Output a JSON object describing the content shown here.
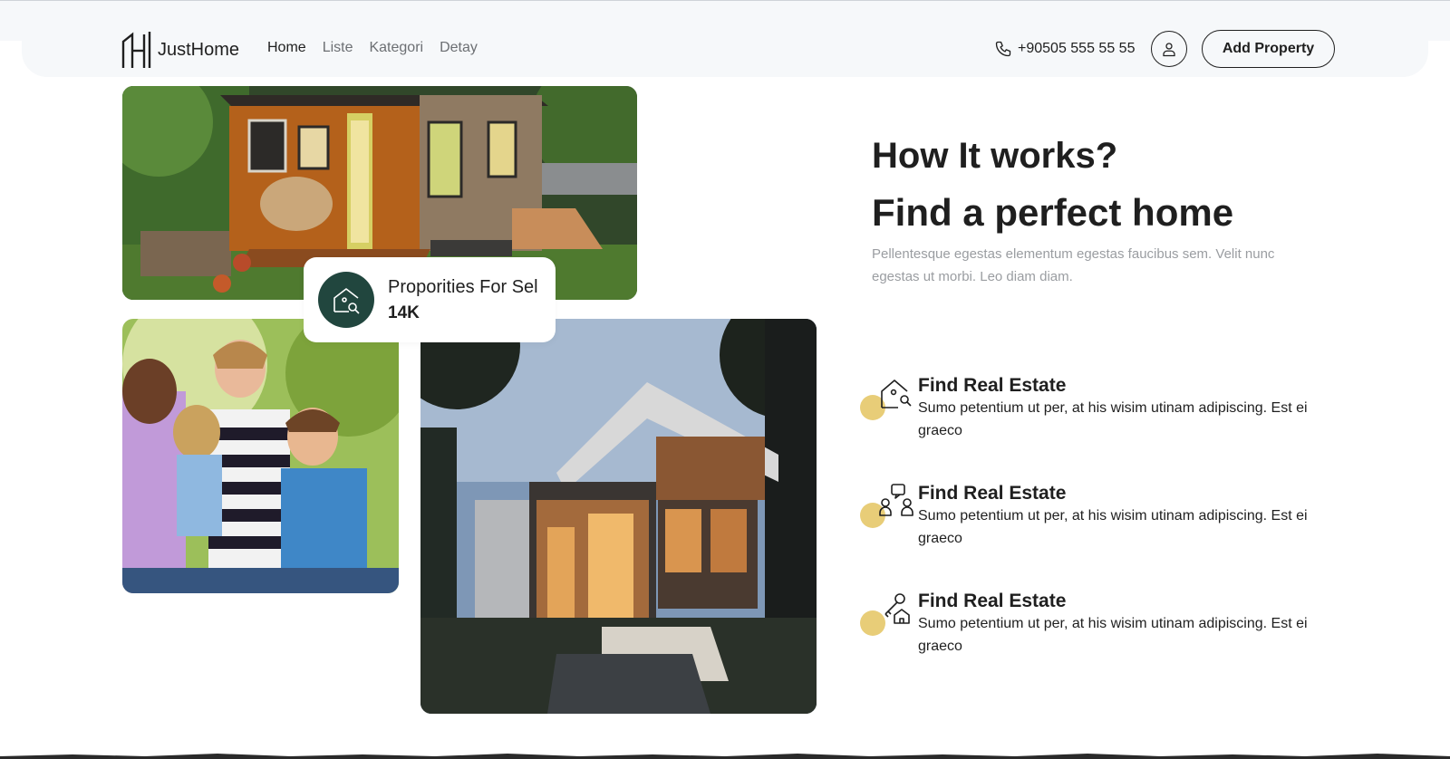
{
  "header": {
    "brand": "JustHome",
    "logo_icon": "justhome-logo-icon",
    "nav": [
      {
        "label": "Home",
        "active": true
      },
      {
        "label": "Liste",
        "active": false
      },
      {
        "label": "Kategori",
        "active": false
      },
      {
        "label": "Detay",
        "active": false
      }
    ],
    "phone": "+90505 555 55 55",
    "phone_icon": "phone-icon",
    "user_icon": "user-icon",
    "add_property": "Add Property"
  },
  "gallery": {
    "images": [
      "tiny-house-photo",
      "family-photo",
      "modern-house-photo"
    ],
    "stat": {
      "label": "Proporities For Sel",
      "value": "14K",
      "icon": "house-search-icon"
    }
  },
  "intro": {
    "kicker": "How It works?",
    "headline": "Find a perfect home",
    "description": "Pellentesque egestas elementum egestas faucibus sem. Velit nunc egestas ut morbi. Leo diam diam."
  },
  "steps": [
    {
      "icon": "house-search-icon",
      "title": "Find Real Estate",
      "text": "Sumo petentium ut per, at his wisim utinam adipiscing. Est ei graeco"
    },
    {
      "icon": "people-chat-icon",
      "title": "Find Real Estate",
      "text": "Sumo petentium ut per, at his wisim utinam adipiscing. Est ei graeco"
    },
    {
      "icon": "key-house-icon",
      "title": "Find Real Estate",
      "text": "Sumo petentium ut per, at his wisim utinam adipiscing. Est ei graeco"
    }
  ],
  "colors": {
    "accent_dark_green": "#21463e",
    "accent_gold": "#e8cd78",
    "nav_background": "#f6f8fa",
    "text_dark": "#1f1f1f",
    "text_muted": "#9a9da1"
  }
}
